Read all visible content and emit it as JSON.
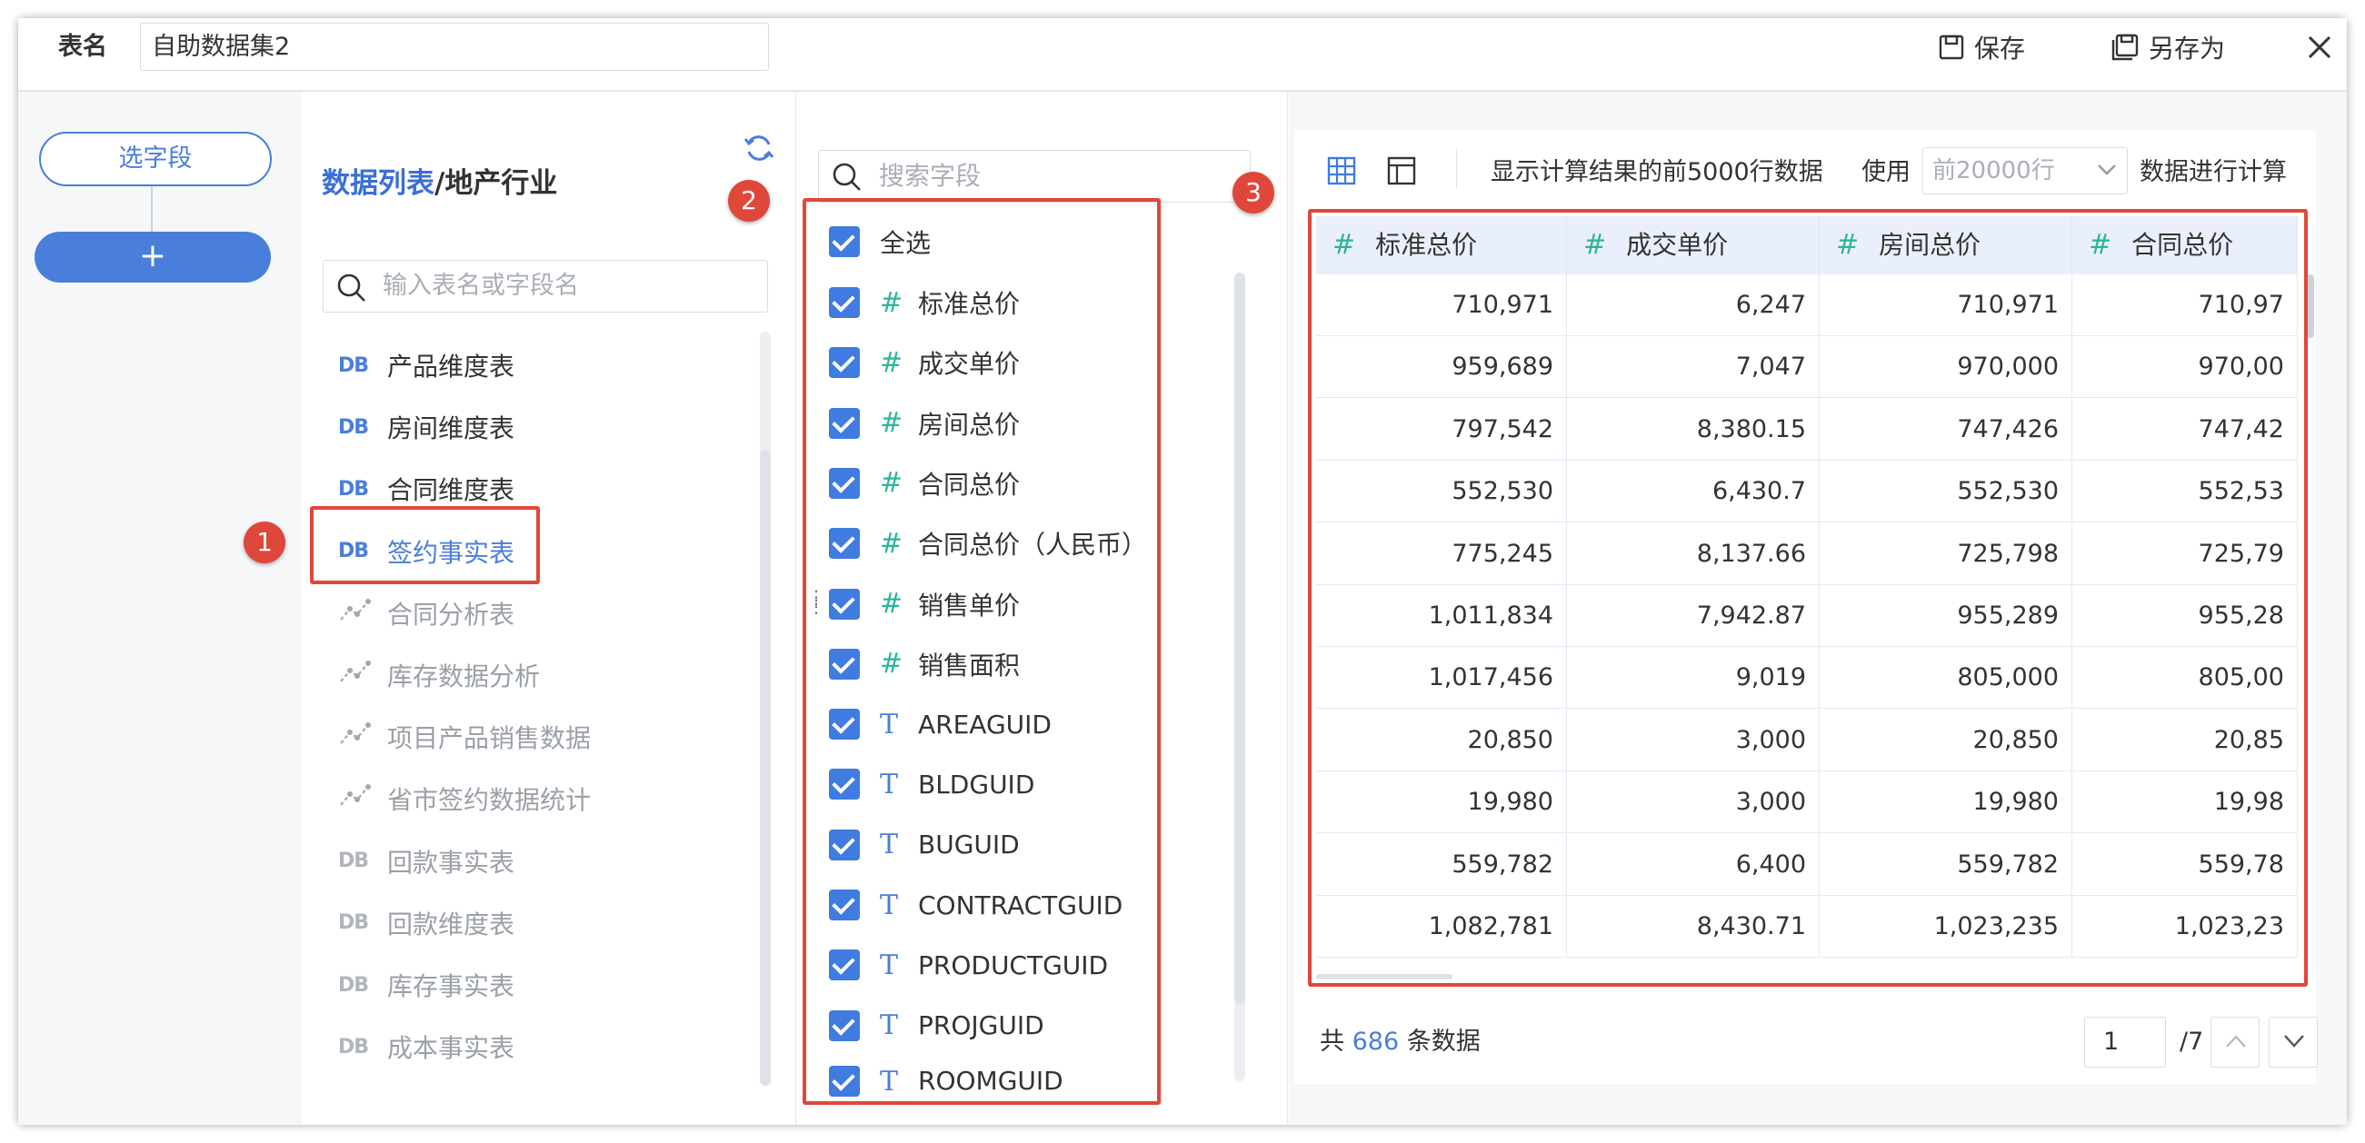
{
  "header": {
    "name_label": "表名",
    "name_value": "自助数据集2",
    "save_label": "保存",
    "save_as_label": "另存为"
  },
  "steps": {
    "select_fields_label": "选字段",
    "add_label": "+"
  },
  "tables_panel": {
    "title_prefix": "数据列表",
    "title_suffix": "/地产行业",
    "search_placeholder": "输入表名或字段名",
    "items": [
      {
        "icon": "DB",
        "label": "产品维度表"
      },
      {
        "icon": "DB",
        "label": "房间维度表"
      },
      {
        "icon": "DB",
        "label": "合同维度表"
      },
      {
        "icon": "DB",
        "label": "签约事实表"
      },
      {
        "icon": "chart",
        "label": "合同分析表"
      },
      {
        "icon": "chart",
        "label": "库存数据分析"
      },
      {
        "icon": "chart",
        "label": "项目产品销售数据"
      },
      {
        "icon": "chart",
        "label": "省市签约数据统计"
      },
      {
        "icon": "DB",
        "label": "回款事实表"
      },
      {
        "icon": "DB",
        "label": "回款维度表"
      },
      {
        "icon": "DB",
        "label": "库存事实表"
      },
      {
        "icon": "DB",
        "label": "成本事实表"
      }
    ]
  },
  "fields_panel": {
    "search_placeholder": "搜索字段",
    "select_all_label": "全选",
    "fields": [
      {
        "type": "#",
        "label": "标准总价"
      },
      {
        "type": "#",
        "label": "成交单价"
      },
      {
        "type": "#",
        "label": "房间总价"
      },
      {
        "type": "#",
        "label": "合同总价"
      },
      {
        "type": "#",
        "label": "合同总价（人民币）"
      },
      {
        "type": "#",
        "label": "销售单价"
      },
      {
        "type": "#",
        "label": "销售面积"
      },
      {
        "type": "T",
        "label": "AREAGUID"
      },
      {
        "type": "T",
        "label": "BLDGUID"
      },
      {
        "type": "T",
        "label": "BUGUID"
      },
      {
        "type": "T",
        "label": "CONTRACTGUID"
      },
      {
        "type": "T",
        "label": "PRODUCTGUID"
      },
      {
        "type": "T",
        "label": "PROJGUID"
      },
      {
        "type": "T",
        "label": "ROOMGUID"
      }
    ]
  },
  "preview": {
    "info_text": "显示计算结果的前5000行数据",
    "use_label": "使用",
    "rows_select_value": "前20000行",
    "compute_label": "数据进行计算",
    "columns": [
      "标准总价",
      "成交单价",
      "房间总价",
      "合同总价"
    ],
    "rows": [
      [
        "710,971",
        "6,247",
        "710,971",
        "710,97"
      ],
      [
        "959,689",
        "7,047",
        "970,000",
        "970,00"
      ],
      [
        "797,542",
        "8,380.15",
        "747,426",
        "747,42"
      ],
      [
        "552,530",
        "6,430.7",
        "552,530",
        "552,53"
      ],
      [
        "775,245",
        "8,137.66",
        "725,798",
        "725,79"
      ],
      [
        "1,011,834",
        "7,942.87",
        "955,289",
        "955,28"
      ],
      [
        "1,017,456",
        "9,019",
        "805,000",
        "805,00"
      ],
      [
        "20,850",
        "3,000",
        "20,850",
        "20,85"
      ],
      [
        "19,980",
        "3,000",
        "19,980",
        "19,98"
      ],
      [
        "559,782",
        "6,400",
        "559,782",
        "559,78"
      ],
      [
        "1,082,781",
        "8,430.71",
        "1,023,235",
        "1,023,23"
      ]
    ],
    "total_prefix": "共",
    "total_count": "686",
    "total_suffix": "条数据",
    "page_current": "1",
    "page_total": "/7"
  },
  "annotations": [
    "1",
    "2",
    "3"
  ],
  "colors": {
    "accent": "#4a7edb",
    "checkbox": "#3f7be0",
    "number_type": "#2bb59a",
    "annotation_red": "#e0473b",
    "header_bg": "#eaf0fb"
  }
}
